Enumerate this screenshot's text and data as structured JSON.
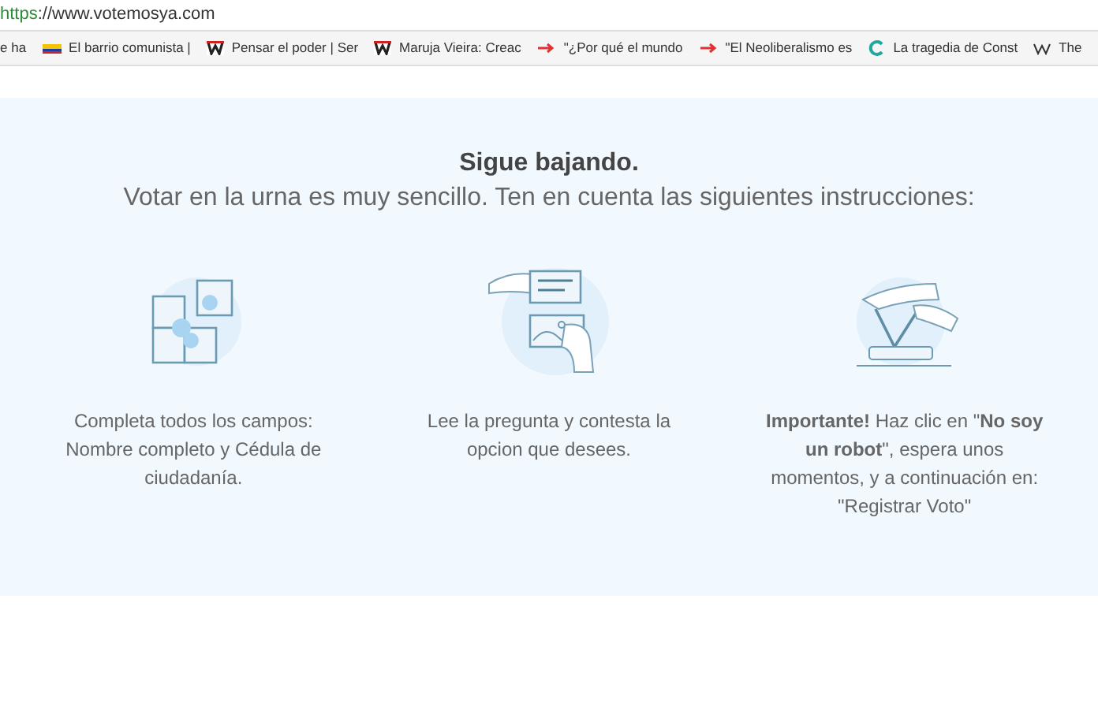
{
  "address_bar": {
    "scheme": "https",
    "rest": "://www.votemosya.com"
  },
  "bookmarks": [
    {
      "label": "e ha",
      "kind": "blank"
    },
    {
      "label": "El barrio comunista |",
      "kind": "flag"
    },
    {
      "label": "Pensar el poder | Ser",
      "kind": "logo"
    },
    {
      "label": "Maruja Vieira: Creac",
      "kind": "logo"
    },
    {
      "label": "\"¿Por qué el mundo",
      "kind": "arrow"
    },
    {
      "label": "\"El Neoliberalismo es",
      "kind": "arrow"
    },
    {
      "label": "La tragedia de Const",
      "kind": "ring"
    },
    {
      "label": "The",
      "kind": "wiki"
    }
  ],
  "heading": "Sigue bajando.",
  "subheading": "Votar en la urna es muy sencillo. Ten en cuenta las siguientes instrucciones:",
  "steps": [
    {
      "kind": "puzzle",
      "text": "Completa todos los campos: Nombre completo y Cédula de ciudadanía."
    },
    {
      "kind": "form",
      "text": "Lee la pregunta y contesta la opcion que desees."
    },
    {
      "kind": "click",
      "text": "**Importante!** Haz clic en \"**No soy un robot**\", espera unos momentos, y a continuación en: \"Registrar Voto\""
    }
  ]
}
